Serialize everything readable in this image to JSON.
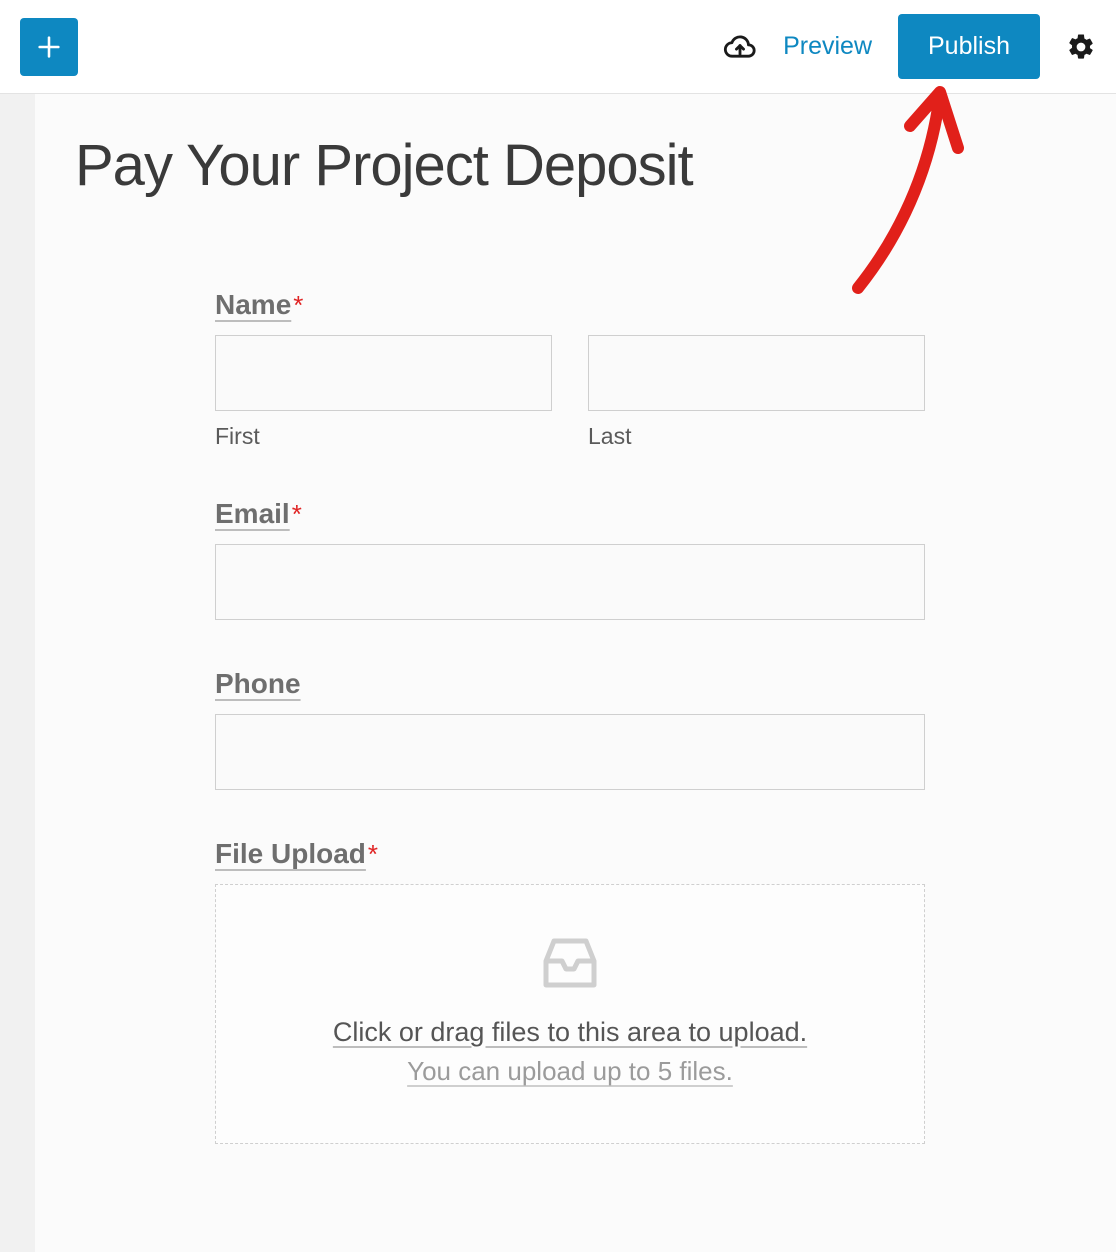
{
  "topbar": {
    "preview_label": "Preview",
    "publish_label": "Publish"
  },
  "page": {
    "title": "Pay Your Project Deposit"
  },
  "form": {
    "name": {
      "label": "Name",
      "required": true,
      "first_sublabel": "First",
      "last_sublabel": "Last"
    },
    "email": {
      "label": "Email",
      "required": true
    },
    "phone": {
      "label": "Phone",
      "required": false
    },
    "file_upload": {
      "label": "File Upload",
      "required": true,
      "dropzone_main": "Click or drag files to this area to upload.",
      "dropzone_sub": "You can upload up to 5 files."
    }
  }
}
